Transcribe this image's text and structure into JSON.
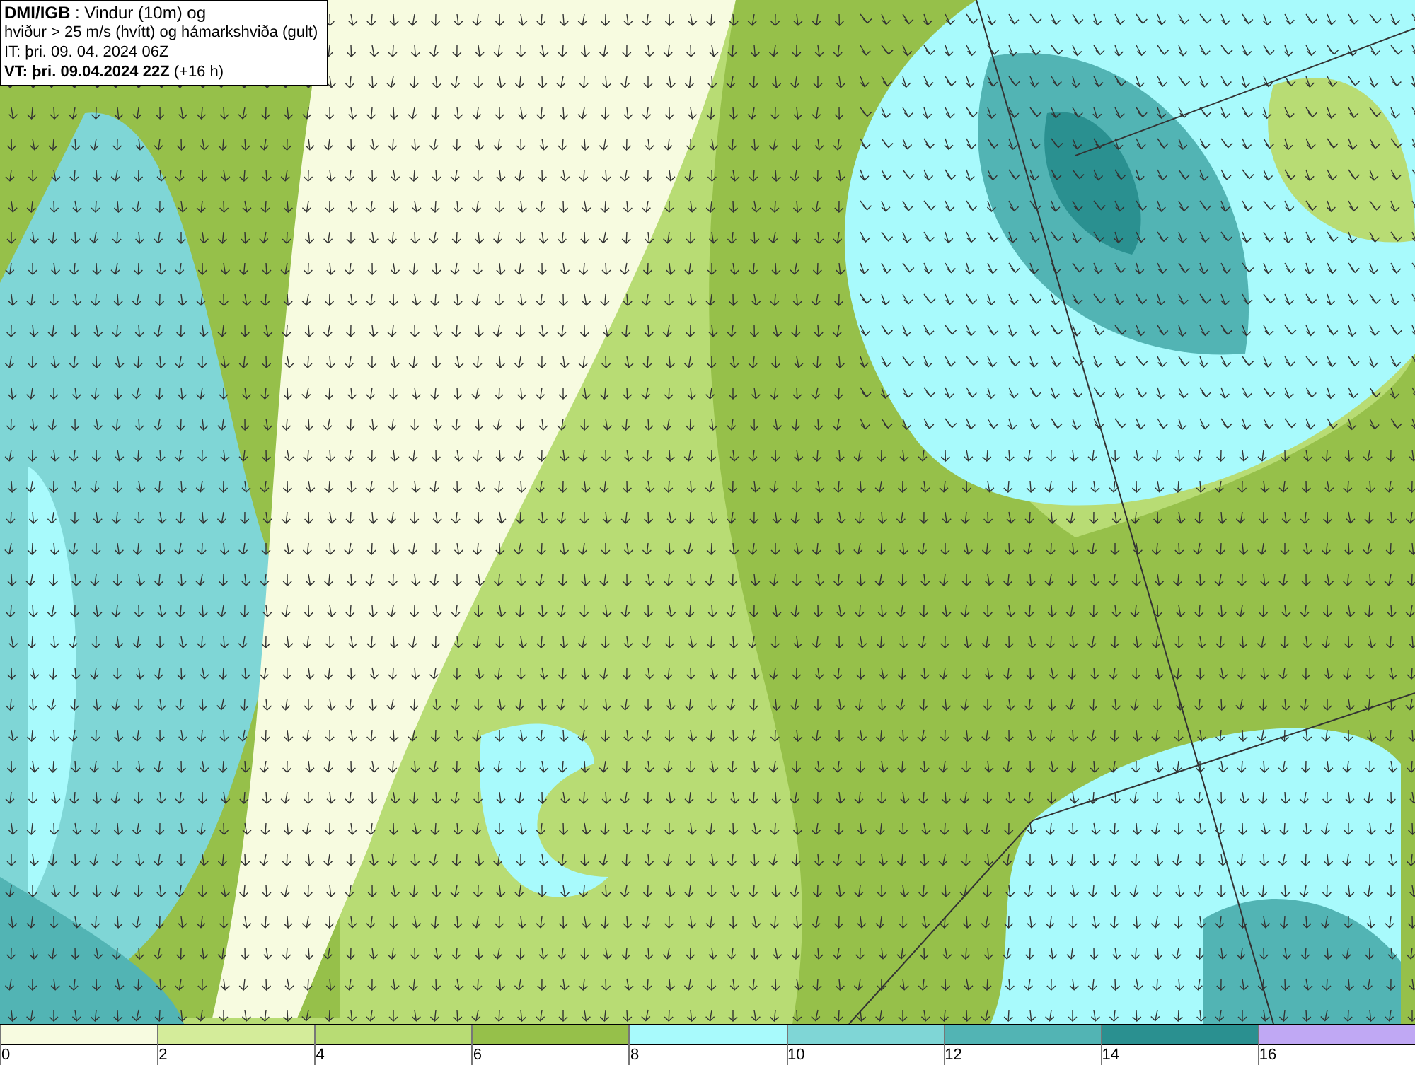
{
  "title_box": {
    "lines": [
      "**DMI/IGB** : Vindur (10m) og",
      "hviður > 25 m/s (hvítt) og hámarkshviða (gult)",
      "IT: þri. 09. 04. 2024 06Z",
      "**VT: þri. 09.04.2024 22Z** (+16 h)"
    ]
  },
  "legend": {
    "segments": [
      {
        "color": "#f7fbe0",
        "tick": "0"
      },
      {
        "color": "#d4ec9a",
        "tick": "2"
      },
      {
        "color": "#b8dc74",
        "tick": "4"
      },
      {
        "color": "#96c04a",
        "tick": "6"
      },
      {
        "color": "#a8fafc",
        "tick": "8"
      },
      {
        "color": "#7fd6d6",
        "tick": "10"
      },
      {
        "color": "#52b4b4",
        "tick": "12"
      },
      {
        "color": "#2a9090",
        "tick": "14"
      },
      {
        "color": "#c0a8f4",
        "tick": "16"
      }
    ]
  }
}
